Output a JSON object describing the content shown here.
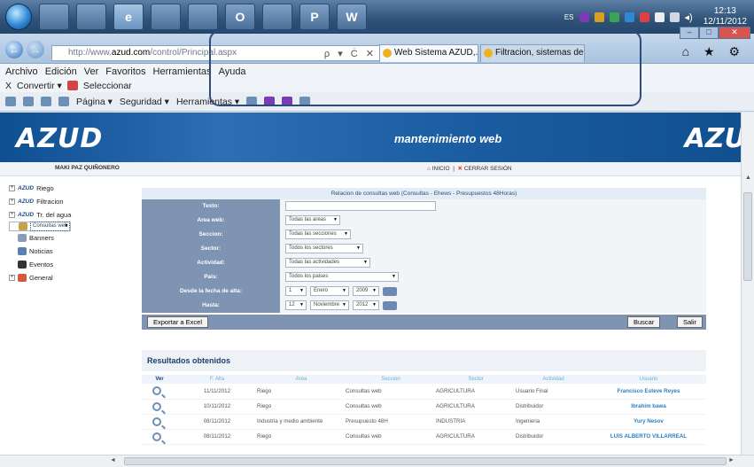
{
  "taskbar": {
    "apps": [
      "",
      "",
      "",
      "e",
      "",
      "",
      "O",
      "",
      "P",
      "W"
    ],
    "lang": "ES",
    "time": "12:13",
    "date": "12/11/2012"
  },
  "browser": {
    "url_prefix": "http://www.",
    "url_host": "azud.com",
    "url_path": "/control/Principal.aspx",
    "addr_controls": "ρ ▾ Ċ ✕",
    "tabs": [
      {
        "label": "Web Sistema AZUD,... ×",
        "active": true
      },
      {
        "label": "Filtracion, sistemas de r...",
        "active": false
      }
    ],
    "right_icons": "⌂ ★ ⚙",
    "menu": [
      "Archivo",
      "Edición",
      "Ver",
      "Favoritos",
      "Herramientas",
      "Ayuda"
    ],
    "convert_bar": [
      "X",
      "Convertir ▾",
      "Seleccionar"
    ],
    "cmd_bar": [
      "Página ▾",
      "Seguridad ▾",
      "Herramientas ▾"
    ]
  },
  "page": {
    "logo": "AZUD",
    "logo_right": "AZU",
    "banner_title": "mantenimiento web",
    "username": "MAKI PAZ QUIÑONERO",
    "home_label": "INICIO",
    "logout_label": "CERRAR SESIÓN",
    "tree": [
      {
        "tag": "AZUD",
        "label": "Riego",
        "sub": false
      },
      {
        "tag": "AZUD",
        "label": "Filtracion",
        "sub": false
      },
      {
        "tag": "AZUD",
        "label": "Tr. del agua",
        "sub": false
      },
      {
        "tag": "",
        "label": "Consultas web",
        "sub": true,
        "selected": true
      },
      {
        "tag": "",
        "label": "Banners",
        "sub": true
      },
      {
        "tag": "",
        "label": "Noticias",
        "sub": true
      },
      {
        "tag": "",
        "label": "Eventos",
        "sub": true
      },
      {
        "tag": "",
        "label": "General",
        "sub": false
      }
    ],
    "filter": {
      "title": "Relacion de consultas web (Consultas - Ehews - Presupuestos 48Horas)",
      "rows": [
        {
          "label": "Texto:",
          "type": "text",
          "value": ""
        },
        {
          "label": "Area web:",
          "type": "select",
          "value": "Todas las areas"
        },
        {
          "label": "Seccion:",
          "type": "select",
          "value": "Todas las secciones"
        },
        {
          "label": "Sector:",
          "type": "select",
          "value": "Todos los sectores"
        },
        {
          "label": "Actividad:",
          "type": "select",
          "value": "Todas las actividades"
        },
        {
          "label": "Pais:",
          "type": "select",
          "value": "Todos los paises"
        }
      ],
      "desde_label": "Desde la fecha de alta:",
      "desde": {
        "day": "1",
        "month": "Enero",
        "year": "2009"
      },
      "hasta_label": "Hasta:",
      "hasta": {
        "day": "12",
        "month": "Noviembre",
        "year": "2012"
      },
      "export_label": "Exportar a Excel",
      "search_label": "Buscar",
      "exit_label": "Salir"
    },
    "results": {
      "heading": "Resultados obtenidos",
      "columns": [
        "Ver",
        "F. Alta",
        "Area",
        "Seccion",
        "Sector",
        "Actividad",
        "Usuario"
      ],
      "rows": [
        [
          "11/11/2012",
          "Riego",
          "Consultas web",
          "AGRICULTURA",
          "Usuario Final",
          "Francisco Esteve Reyes"
        ],
        [
          "10/11/2012",
          "Riego",
          "Consultas web",
          "AGRICULTURA",
          "Distribuidor",
          "Ibrahim bawa"
        ],
        [
          "08/11/2012",
          "Industria y medio ambiente",
          "Presupuesto 48H",
          "INDUSTRIA",
          "Ingenieria",
          "Yury Nesov"
        ],
        [
          "08/11/2012",
          "Riego",
          "Consultas web",
          "AGRICULTURA",
          "Distribuidor",
          "LUIS ALBERTO VILLARREAL"
        ]
      ]
    }
  }
}
